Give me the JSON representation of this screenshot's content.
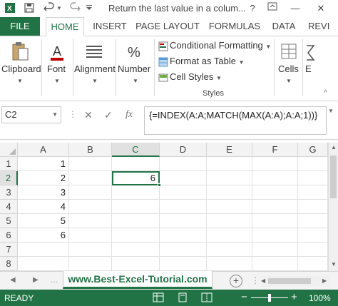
{
  "window": {
    "title": "Return the last value in a colum...",
    "help": "?",
    "minimize": "—",
    "close": "✕"
  },
  "tabs": [
    "FILE",
    "HOME",
    "INSERT",
    "PAGE LAYOUT",
    "FORMULAS",
    "DATA",
    "REVI"
  ],
  "ribbon": {
    "clipboard": "Clipboard",
    "font": "Font",
    "alignment": "Alignment",
    "number": "Number",
    "conditional_formatting": "Conditional Formatting",
    "format_as_table": "Format as Table",
    "cell_styles": "Cell Styles",
    "styles_group": "Styles",
    "cells": "Cells",
    "editing": "E",
    "font_icon_letter": "A",
    "number_icon": "%"
  },
  "formula_bar": {
    "name_box": "C2",
    "cancel": "✕",
    "enter": "✓",
    "fx": "fx",
    "formula": "{=INDEX(A:A;MATCH(MAX(A:A);A:A;1))}"
  },
  "sheet": {
    "columns": [
      "A",
      "B",
      "C",
      "D",
      "E",
      "F",
      "G"
    ],
    "rows": [
      "1",
      "2",
      "3",
      "4",
      "5",
      "6",
      "7",
      "8"
    ],
    "col_a_values": [
      "1",
      "2",
      "3",
      "4",
      "5",
      "6",
      "",
      ""
    ],
    "c2_value": "6",
    "selected_cell": "C2"
  },
  "sheet_tabs": {
    "active": "www.Best-Excel-Tutorial.com",
    "add": "+"
  },
  "status": {
    "mode": "READY",
    "zoom": "100%",
    "zoom_minus": "−",
    "zoom_plus": "+"
  },
  "colors": {
    "accent": "#217346",
    "header_bg": "#f3f3f3",
    "grid_line": "#e1e1e1"
  }
}
